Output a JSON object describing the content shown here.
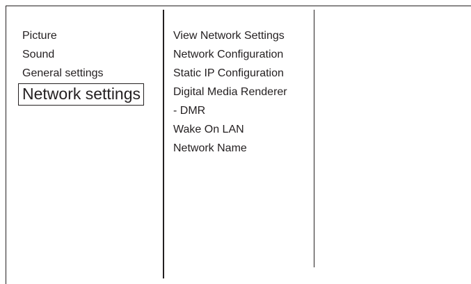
{
  "menu": {
    "main_items": [
      {
        "label": "Picture"
      },
      {
        "label": "Sound"
      },
      {
        "label": "General settings"
      },
      {
        "label": "Network settings",
        "selected": true
      }
    ],
    "sub_items": [
      {
        "label": "View Network Settings"
      },
      {
        "label": "Network Configuration"
      },
      {
        "label": "Static IP Configuration"
      },
      {
        "label": "Digital Media Renderer"
      },
      {
        "label": "- DMR"
      },
      {
        "label": "Wake On LAN"
      },
      {
        "label": "Network Name"
      }
    ]
  }
}
